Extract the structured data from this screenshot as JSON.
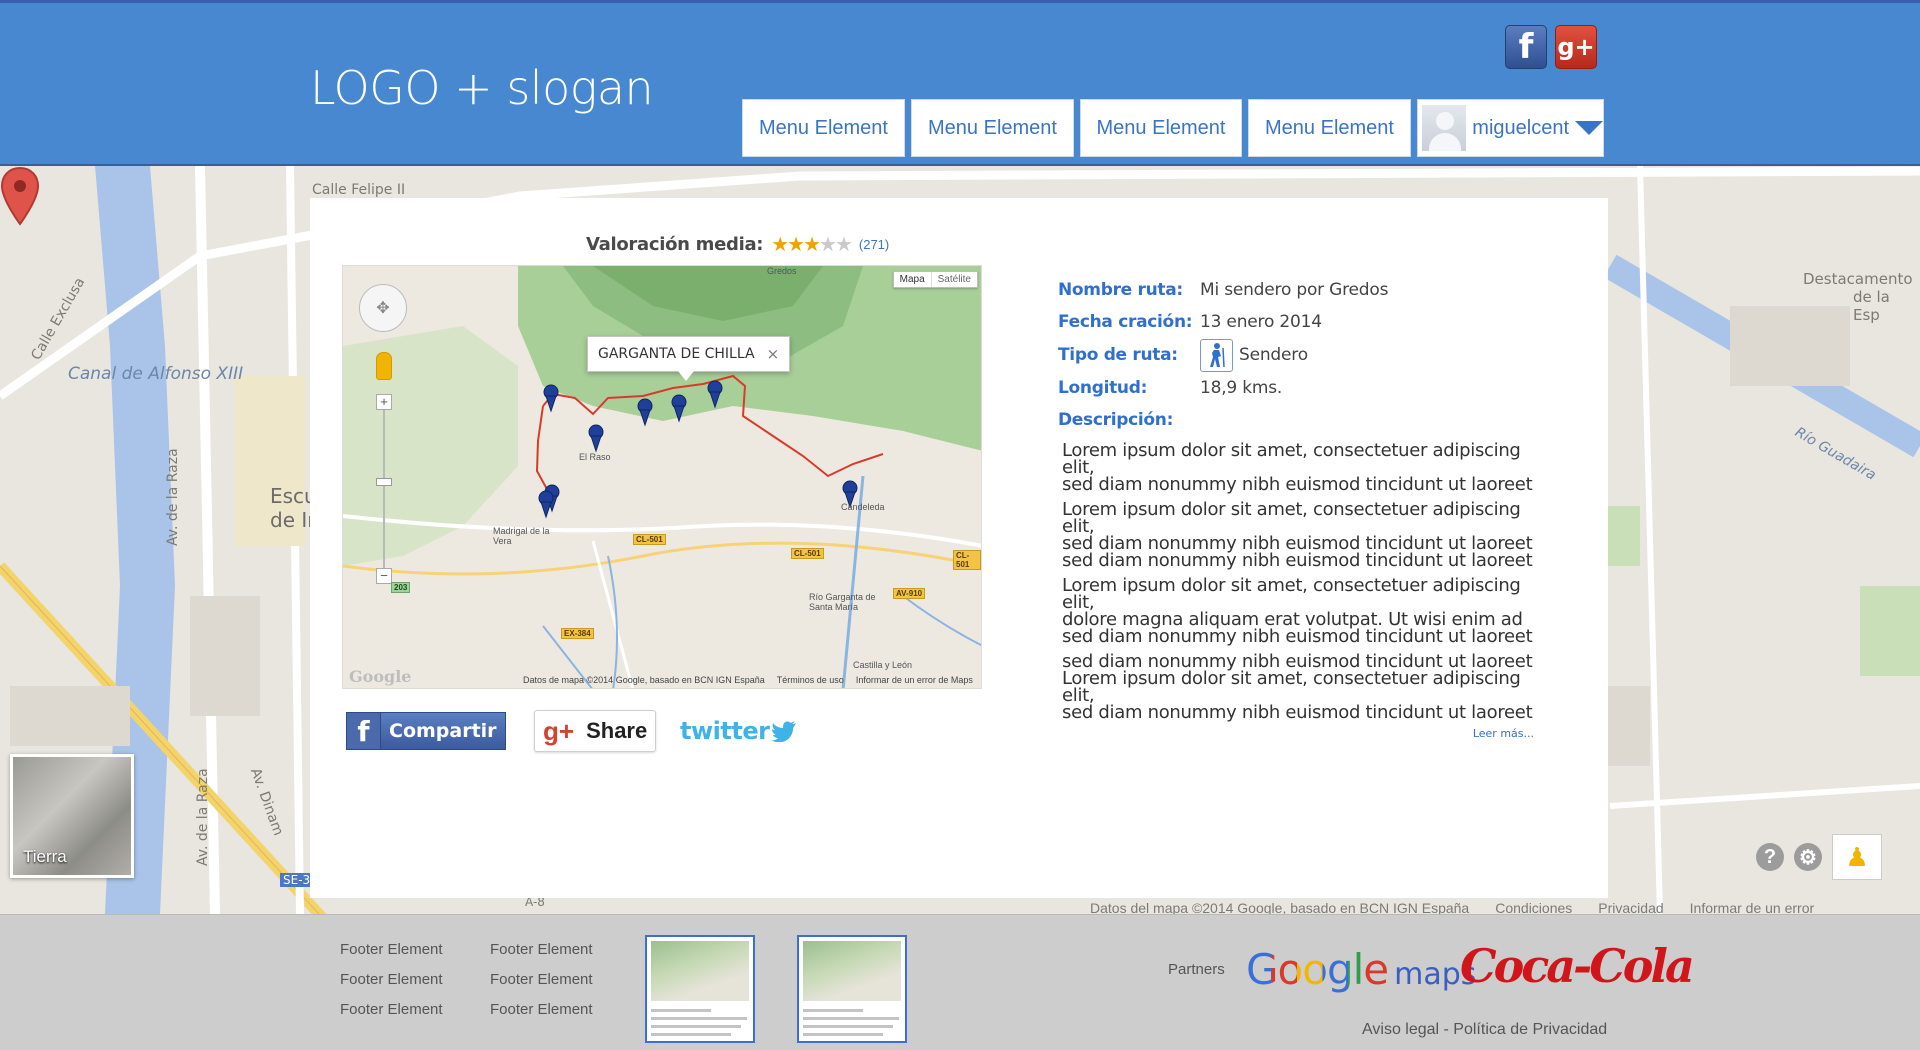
{
  "header": {
    "logo_text": "LOGO + slogan",
    "social": {
      "facebook_glyph": "f",
      "googleplus_glyph": "g+"
    },
    "menu": [
      "Menu Element",
      "Menu Element",
      "Menu Element",
      "Menu Element"
    ],
    "user": {
      "name": "miguelcent"
    }
  },
  "background_map": {
    "streets": [
      "Calle Felipe II",
      "Calle Exclusa",
      "Av. de la Raza",
      "Av. de la Raza",
      "Av. Dinam",
      "Río Guadaira"
    ],
    "canal": "Canal de Alfonso XIII",
    "place_partial": [
      "Escu",
      "de Ir"
    ],
    "place_right": [
      "Destacamento",
      "de la Esp"
    ],
    "road_codes": [
      "SE-3",
      "A-8"
    ],
    "tierra_label": "Tierra",
    "attribution": [
      "Datos del mapa ©2014 Google, basado en BCN IGN España",
      "Condiciones",
      "Privacidad",
      "Informar de un error"
    ]
  },
  "rating": {
    "label": "Valoración media:",
    "stars_filled": 3,
    "stars_total": 5,
    "count": "(271)"
  },
  "route_map": {
    "map_type": [
      "Mapa",
      "Satélite"
    ],
    "callout": "GARGANTA DE CHILLA",
    "callout_close": "×",
    "places": [
      "Gredos",
      "El Raso",
      "Madrigal de la Vera",
      "Candeleda",
      "Río Garganta de Santa María",
      "Castilla y León"
    ],
    "roads": [
      "CL-501",
      "CL-501",
      "CL-501",
      "EX-384",
      "AV-910",
      "203"
    ],
    "attribution": [
      "Datos de mapa ©2014 Google, basado en BCN IGN España",
      "Términos de uso",
      "Informar de un error de Maps"
    ],
    "watermark": "Google"
  },
  "share": {
    "facebook": "Compartir",
    "googleplus": "Share",
    "twitter": "twitter"
  },
  "details": {
    "nombre_label": "Nombre ruta:",
    "nombre_value": "Mi sendero por Gredos",
    "fecha_label": "Fecha cración:",
    "fecha_value": "13 enero 2014",
    "tipo_label": "Tipo de ruta:",
    "tipo_value": "Sendero",
    "tipo_icon": "hiker-icon",
    "longitud_label": "Longitud:",
    "longitud_value": "18,9 kms.",
    "descripcion_label": "Descripción:",
    "descripcion": [
      [
        "Lorem ipsum dolor sit amet, consectetuer adipiscing elit,",
        " sed diam nonummy nibh euismod tincidunt ut laoreet"
      ],
      [
        "Lorem ipsum dolor sit amet, consectetuer adipiscing elit,",
        "sed diam nonummy nibh euismod tincidunt ut laoreet",
        "sed diam nonummy nibh euismod tincidunt ut laoreet"
      ],
      [
        "Lorem ipsum dolor sit amet, consectetuer adipiscing elit,",
        "dolore magna aliquam erat volutpat. Ut wisi enim ad",
        "sed diam nonummy nibh euismod tincidunt ut laoreet"
      ],
      [
        "sed diam nonummy nibh euismod tincidunt ut laoreet",
        " Lorem ipsum dolor sit amet, consectetuer adipiscing elit,",
        "sed diam nonummy nibh euismod tincidunt ut laoreet"
      ]
    ],
    "leer_mas": "Leer más..."
  },
  "footer": {
    "col1": [
      "Footer Element",
      "Footer Element",
      "Footer Element"
    ],
    "col2": [
      "Footer Element",
      "Footer Element",
      "Footer Element"
    ],
    "partners_label": "Partners",
    "partner_google": "Google",
    "partner_maps": "maps",
    "partner_coke": "Coca-Cola",
    "legal": "Aviso legal - Política de Privacidad"
  },
  "colors": {
    "header": "#4888d0",
    "link_blue": "#2f6fce",
    "route_red": "#d93a2b",
    "marker_blue": "#1f3f9a"
  }
}
